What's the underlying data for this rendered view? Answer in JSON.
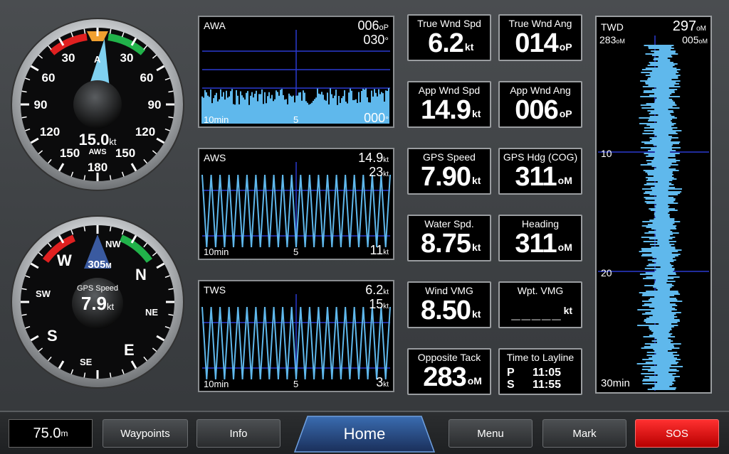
{
  "wind_gauge": {
    "ticks_left": [
      "30",
      "60",
      "90",
      "120",
      "150"
    ],
    "ticks_right": [
      "30",
      "60",
      "90",
      "120",
      "150"
    ],
    "bottom": "180",
    "top_marker": "A",
    "speed": "15.0",
    "unit": "kt",
    "label": "AWS",
    "pointer_angle_deg": 6,
    "colors": {
      "port": "#e02020",
      "starboard": "#21b24a",
      "bow_marker": "#f0a030",
      "needle": "#7fd0f0"
    }
  },
  "compass_gauge": {
    "cardinals": {
      "N": "N",
      "E": "E",
      "S": "S",
      "W": "W"
    },
    "intercardinals": {
      "NE": "NE",
      "SE": "SE",
      "SW": "SW",
      "NW": "NW"
    },
    "heading": "305",
    "heading_unit": "M",
    "label": "GPS Speed",
    "speed": "7.9",
    "unit": "kt"
  },
  "graphs": [
    {
      "name": "AWA",
      "val1": "006",
      "val1_unit": "oP",
      "val2": "030",
      "val2_unit": "°",
      "left": "10min",
      "mid": "5",
      "right": "000",
      "right_unit": "°",
      "type": "bars"
    },
    {
      "name": "AWS",
      "val1": "14.9",
      "val1_unit": "kt",
      "val2": "23",
      "val2_unit": "kt",
      "left": "10min",
      "mid": "5",
      "right": "11",
      "right_unit": "kt",
      "type": "zigzag"
    },
    {
      "name": "TWS",
      "val1": "6.2",
      "val1_unit": "kt",
      "val2": "15",
      "val2_unit": "kt",
      "left": "10min",
      "mid": "5",
      "right": "3",
      "right_unit": "kt",
      "type": "zigzag"
    }
  ],
  "tiles": {
    "true_wnd_spd": {
      "label": "True Wnd Spd",
      "value": "6.2",
      "unit": "kt"
    },
    "true_wnd_ang": {
      "label": "True Wnd Ang",
      "value": "014",
      "unit": "oP"
    },
    "app_wnd_spd": {
      "label": "App Wnd Spd",
      "value": "14.9",
      "unit": "kt"
    },
    "app_wnd_ang": {
      "label": "App Wnd Ang",
      "value": "006",
      "unit": "oP"
    },
    "gps_speed": {
      "label": "GPS Speed",
      "value": "7.90",
      "unit": "kt"
    },
    "gps_hdg": {
      "label": "GPS Hdg (COG)",
      "value": "311",
      "unit": "oM"
    },
    "water_spd": {
      "label": "Water Spd.",
      "value": "8.75",
      "unit": "kt"
    },
    "heading": {
      "label": "Heading",
      "value": "311",
      "unit": "oM"
    },
    "wind_vmg": {
      "label": "Wind VMG",
      "value": "8.50",
      "unit": "kt"
    },
    "wpt_vmg": {
      "label": "Wpt. VMG",
      "value": "_____",
      "unit": "kt"
    },
    "opposite_tack": {
      "label": "Opposite Tack",
      "value": "283",
      "unit": "oM"
    },
    "time_to_layline": {
      "label": "Time to Layline",
      "p_label": "P",
      "p_time": "11:05",
      "s_label": "S",
      "s_time": "11:55"
    }
  },
  "twd": {
    "title": "TWD",
    "value": "297",
    "value_unit": "oM",
    "left_range": "283",
    "left_unit": "oM",
    "right_range": "005",
    "right_unit": "oM",
    "mark_10": "10",
    "mark_20": "20",
    "bottom": "30min"
  },
  "bottom_bar": {
    "depth": "75.0",
    "depth_unit": "m",
    "waypoints": "Waypoints",
    "info": "Info",
    "home": "Home",
    "menu": "Menu",
    "mark": "Mark",
    "sos": "SOS"
  },
  "colors": {
    "trace": "#5fb8ec",
    "grid": "#2a3ad0",
    "sos": "#e81010"
  }
}
